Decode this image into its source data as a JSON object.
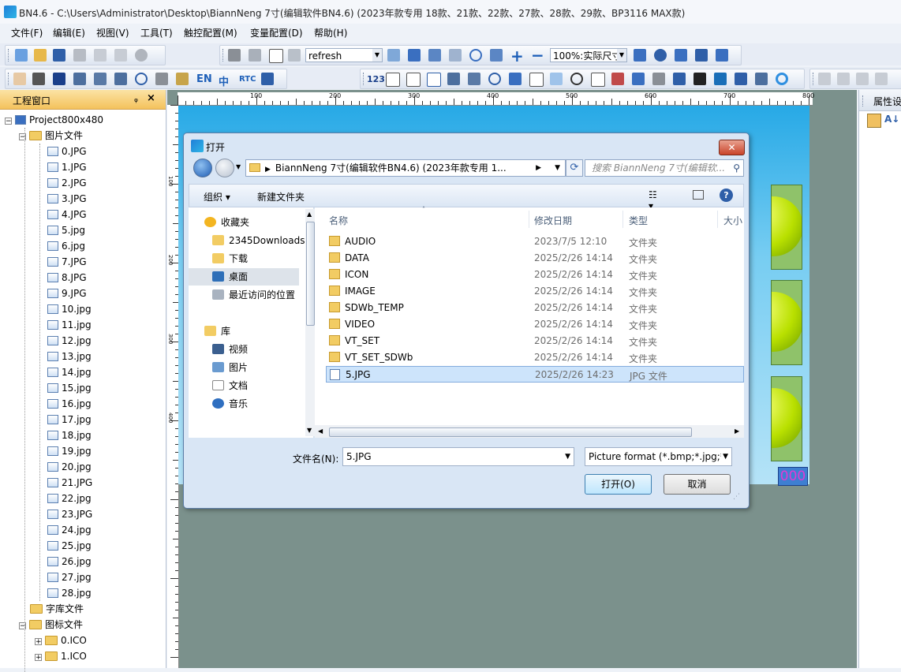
{
  "window": {
    "title": "BN4.6 - C:\\Users\\Administrator\\Desktop\\BiannNeng 7寸(编辑软件BN4.6) (2023年款专用 18款、21款、22款、27款、28款、29款、BP3116 MAX款)"
  },
  "menu": [
    "文件(F)",
    "编辑(E)",
    "视图(V)",
    "工具(T)",
    "触控配置(M)",
    "变量配置(D)",
    "帮助(H)"
  ],
  "toolbar": {
    "refresh_value": "refresh",
    "zoom_value": "100%:实际尺寸",
    "en_label": "EN",
    "zh_label": "中",
    "rtc_label": "RTC",
    "num_label": "123"
  },
  "project_panel": {
    "title": "工程窗口",
    "root": "Project800x480",
    "image_folder": "图片文件",
    "images": [
      "0.JPG",
      "1.JPG",
      "2.JPG",
      "3.JPG",
      "4.JPG",
      "5.jpg",
      "6.jpg",
      "7.JPG",
      "8.JPG",
      "9.JPG",
      "10.jpg",
      "11.jpg",
      "12.jpg",
      "13.jpg",
      "14.jpg",
      "15.jpg",
      "16.jpg",
      "17.jpg",
      "18.jpg",
      "19.jpg",
      "20.jpg",
      "21.JPG",
      "22.jpg",
      "23.JPG",
      "24.jpg",
      "25.jpg",
      "26.jpg",
      "27.jpg",
      "28.jpg"
    ],
    "font_folder": "字库文件",
    "icon_folder": "图标文件",
    "icons": [
      "0.ICO",
      "1.ICO"
    ]
  },
  "ruler": {
    "h_ticks": [
      "100",
      "200",
      "300",
      "400",
      "500",
      "600",
      "700",
      "800"
    ],
    "v_ticks": [
      "100",
      "200",
      "300",
      "400"
    ]
  },
  "canvas": {
    "counter": "000"
  },
  "properties_panel": {
    "title": "属性设"
  },
  "dialog": {
    "title": "打开",
    "address": "BiannNeng 7寸(编辑软件BN4.6) (2023年款专用 1...",
    "search_placeholder": "搜索 BiannNeng 7寸(编辑软...",
    "organize": "组织 ▾",
    "new_folder": "新建文件夹",
    "nav": [
      {
        "label": "收藏夹"
      },
      {
        "label": "2345Downloads"
      },
      {
        "label": "下载"
      },
      {
        "label": "桌面"
      },
      {
        "label": "最近访问的位置"
      },
      {
        "label": "库"
      },
      {
        "label": "视频"
      },
      {
        "label": "图片"
      },
      {
        "label": "文档"
      },
      {
        "label": "音乐"
      }
    ],
    "columns": {
      "name": "名称",
      "date": "修改日期",
      "type": "类型",
      "size": "大小"
    },
    "files": [
      {
        "name": "AUDIO",
        "date": "2023/7/5 12:10",
        "type": "文件夹"
      },
      {
        "name": "DATA",
        "date": "2025/2/26 14:14",
        "type": "文件夹"
      },
      {
        "name": "ICON",
        "date": "2025/2/26 14:14",
        "type": "文件夹"
      },
      {
        "name": "IMAGE",
        "date": "2025/2/26 14:14",
        "type": "文件夹"
      },
      {
        "name": "SDWb_TEMP",
        "date": "2025/2/26 14:14",
        "type": "文件夹"
      },
      {
        "name": "VIDEO",
        "date": "2025/2/26 14:14",
        "type": "文件夹"
      },
      {
        "name": "VT_SET",
        "date": "2025/2/26 14:14",
        "type": "文件夹"
      },
      {
        "name": "VT_SET_SDWb",
        "date": "2025/2/26 14:14",
        "type": "文件夹"
      },
      {
        "name": "5.JPG",
        "date": "2025/2/26 14:23",
        "type": "JPG 文件"
      }
    ],
    "filename_label": "文件名(N):",
    "filename_value": "5.JPG",
    "filetype_value": "Picture format (*.bmp;*.jpg;*",
    "open_button": "打开(O)",
    "cancel_button": "取消"
  }
}
